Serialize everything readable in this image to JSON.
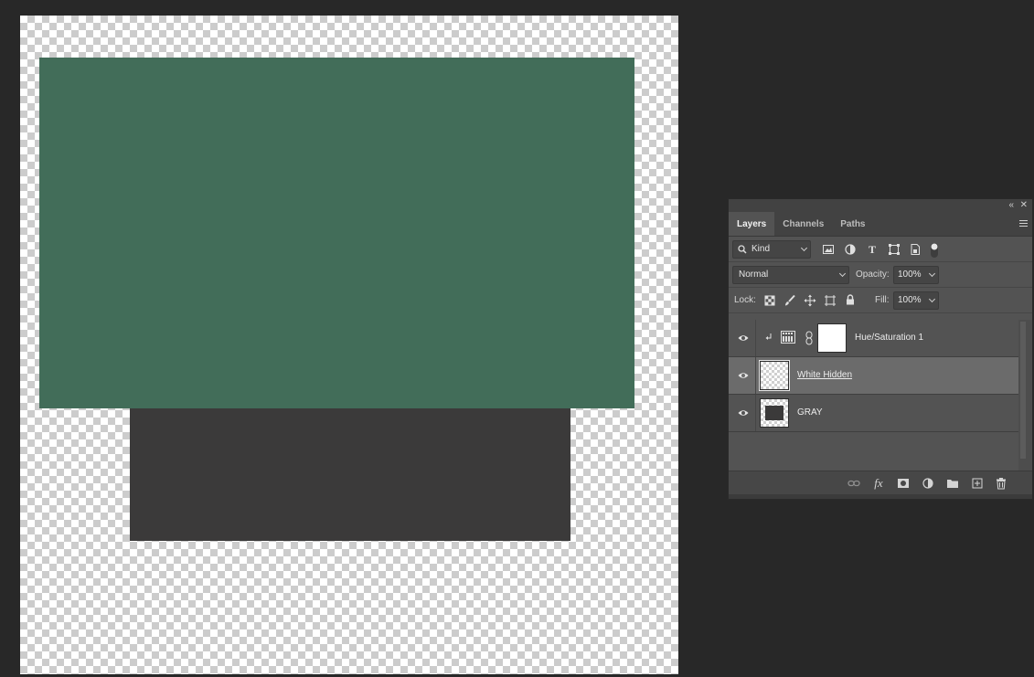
{
  "canvas": {
    "layers": [
      {
        "name": "green",
        "color": "#426d59"
      },
      {
        "name": "gray",
        "color": "#3b3a3a"
      }
    ]
  },
  "panel": {
    "tabs": [
      {
        "label": "Layers",
        "active": true
      },
      {
        "label": "Channels",
        "active": false
      },
      {
        "label": "Paths",
        "active": false
      }
    ],
    "filter": {
      "value": "Kind"
    },
    "blend_mode": {
      "value": "Normal"
    },
    "opacity": {
      "label": "Opacity:",
      "value": "100%"
    },
    "lock": {
      "label": "Lock:"
    },
    "fill": {
      "label": "Fill:",
      "value": "100%"
    },
    "layers": [
      {
        "name": "Hue/Saturation 1",
        "visible": true,
        "selected": false,
        "type": "adjustment"
      },
      {
        "name": "White Hidden ",
        "visible": true,
        "selected": true,
        "type": "pixel"
      },
      {
        "name": "GRAY",
        "visible": true,
        "selected": false,
        "type": "pixel"
      }
    ],
    "icons": {
      "collapse": "double-chevron-left-icon",
      "close": "close-icon",
      "menu": "hamburger-menu-icon"
    }
  }
}
